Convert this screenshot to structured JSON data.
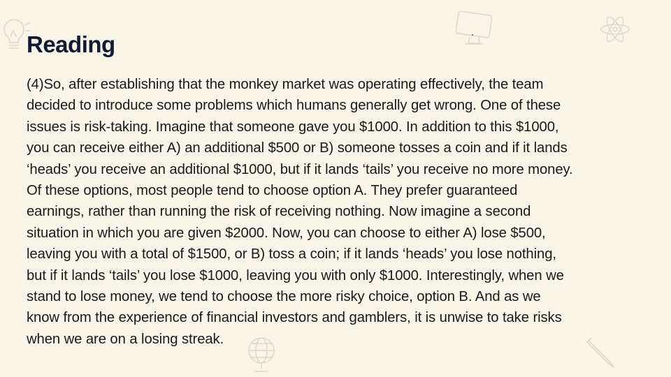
{
  "slide": {
    "title": "Reading",
    "paragraph": "(4)So, after establishing that the monkey market was operating effectively, the team\ndecided to introduce some problems which humans generally get wrong. One of these\nissues is risk-taking. Imagine that someone gave you $1000. In addition to this $1000,\nyou can receive either A) an additional $500 or B) someone tosses a coin and if it lands\n‘heads’ you receive an additional $1000, but if it lands ‘tails’ you receive no more money.\nOf these options, most people tend to choose option A. They prefer guaranteed\nearnings, rather than running the risk of receiving nothing. Now imagine a second\nsituation in which you are given $2000. Now, you can choose to either A) lose $500,\nleaving you with a total of $1500, or B) toss a coin; if it lands ‘heads’ you lose nothing,\nbut if it lands ‘tails’ you lose $1000, leaving you with only $1000. Interestingly, when we\nstand to lose money, we tend to choose the more risky choice, option B. And as we\nknow from the experience of financial investors and gamblers, it is unwise to take risks\nwhen we are on a losing streak."
  },
  "decorations": {
    "icons": [
      "lightbulb-icon",
      "monitor-icon",
      "atom-icon",
      "globe-icon",
      "pencil-icon"
    ],
    "line_color": "#c9c4b8"
  },
  "colors": {
    "background": "#f9f4e8",
    "title": "#101a33",
    "text": "#1a1a1a"
  }
}
